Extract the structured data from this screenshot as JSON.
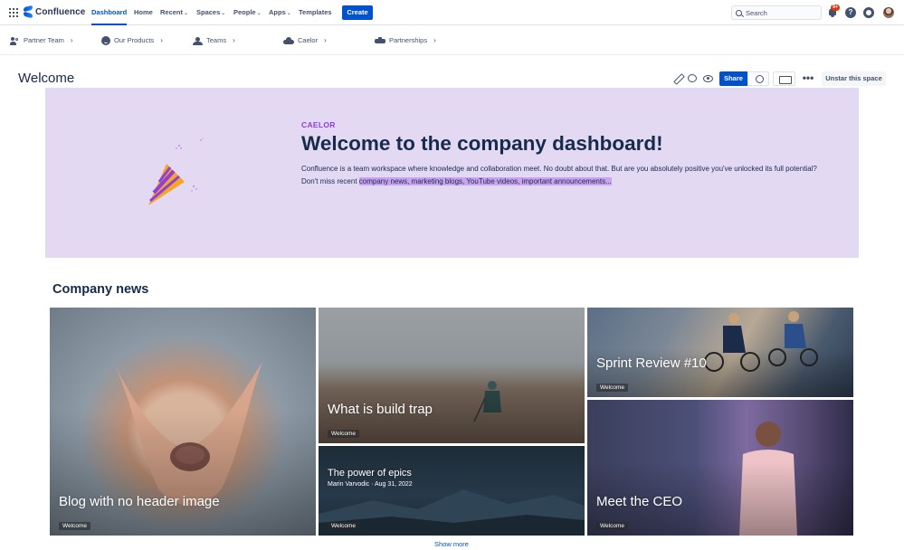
{
  "app": {
    "name": "Confluence"
  },
  "topnav": {
    "items": [
      {
        "label": "Dashboard",
        "active": true
      },
      {
        "label": "Home"
      },
      {
        "label": "Recent"
      },
      {
        "label": "Spaces"
      },
      {
        "label": "People"
      },
      {
        "label": "Apps"
      },
      {
        "label": "Templates"
      }
    ],
    "create_label": "Create",
    "search_placeholder": "Search",
    "notification_badge": "9+",
    "help_glyph": "?"
  },
  "subnav": {
    "items": [
      {
        "label": "Partner Team",
        "icon": "people-icon"
      },
      {
        "label": "Our Products",
        "icon": "smile-icon"
      },
      {
        "label": "Teams",
        "icon": "teams-icon"
      },
      {
        "label": "Caelor",
        "icon": "cloud-icon"
      },
      {
        "label": "Partnerships",
        "icon": "handshake-icon"
      }
    ]
  },
  "page": {
    "title": "Welcome",
    "share_label": "Share",
    "more_glyph": "•••",
    "unstar_label": "Unstar this space"
  },
  "hero": {
    "eyebrow": "CAELOR",
    "title": "Welcome to the company dashboard!",
    "text_plain": "Confluence is a team workspace where knowledge and collaboration meet. No doubt about that. But are you absolutely positive you've unlocked its full potential? Don't miss recent ",
    "text_highlight": "company news, marketing blogs, YouTube videos, important announcements...",
    "bg_color": "#e3d9f3",
    "accent_color": "#8f3ee0"
  },
  "news": {
    "title": "Company news",
    "cards": [
      {
        "title": "Blog with no header image",
        "tag": "Welcome"
      },
      {
        "title": "What is build trap",
        "tag": "Welcome"
      },
      {
        "title": "Sprint Review #10",
        "tag": "Welcome"
      },
      {
        "title": "The power of epics",
        "meta": "Marin Varvodic · Aug 31, 2022",
        "tag": "Welcome"
      },
      {
        "title": "Meet the CEO",
        "tag": "Welcome"
      }
    ],
    "show_more": "Show more"
  },
  "colors": {
    "brand": "#0052cc",
    "text": "#172b4d",
    "muted": "#42526e"
  }
}
